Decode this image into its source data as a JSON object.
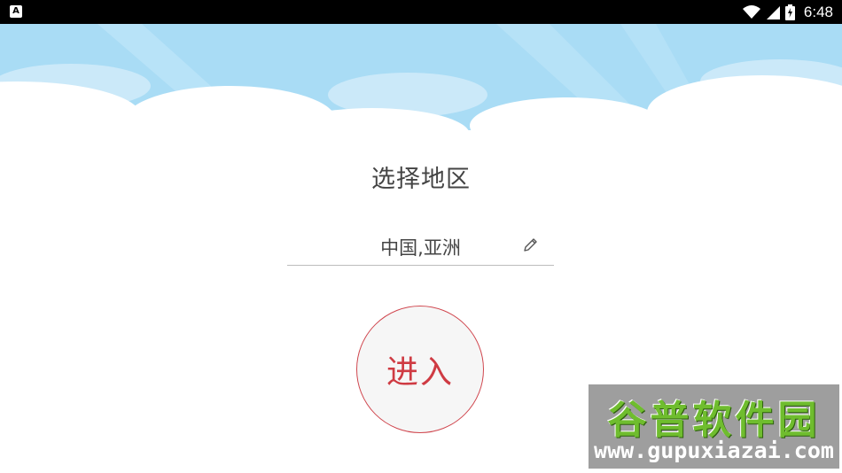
{
  "status_bar": {
    "time": "6:48",
    "icons": [
      "notification-a-icon",
      "wifi-icon",
      "signal-icon",
      "battery-icon"
    ]
  },
  "page": {
    "title": "选择地区",
    "region_value": "中国,亚洲",
    "enter_label": "进入"
  },
  "watermark": {
    "name": "谷普软件园",
    "url": "www.gupuxiazai.com"
  },
  "colors": {
    "sky": "#a9dcf5",
    "accent": "#cf3b43",
    "watermark_green": "#6fbd2e"
  }
}
